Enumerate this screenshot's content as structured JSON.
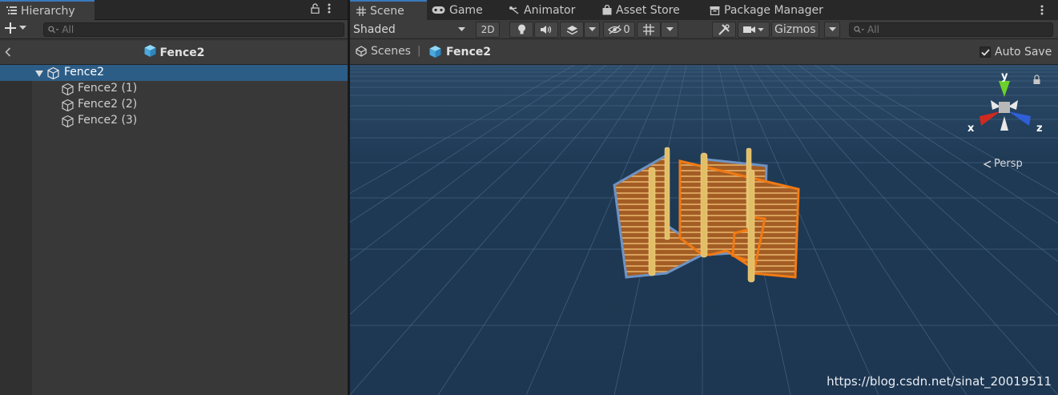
{
  "hierarchy": {
    "tab_label": "Hierarchy",
    "search_placeholder": "All",
    "context_title": "Fence2",
    "items": [
      {
        "label": "Fence2",
        "depth": 0,
        "expanded": true,
        "selected": true
      },
      {
        "label": "Fence2 (1)",
        "depth": 1,
        "expanded": false,
        "selected": false
      },
      {
        "label": "Fence2 (2)",
        "depth": 1,
        "expanded": false,
        "selected": false
      },
      {
        "label": "Fence2 (3)",
        "depth": 1,
        "expanded": false,
        "selected": false
      }
    ]
  },
  "scene_panel": {
    "tabs": [
      {
        "label": "Scene",
        "icon": "grid-icon",
        "active": true
      },
      {
        "label": "Game",
        "icon": "gamepad-icon",
        "active": false
      },
      {
        "label": "Animator",
        "icon": "animator-icon",
        "active": false
      },
      {
        "label": "Asset Store",
        "icon": "store-bag-icon",
        "active": false
      },
      {
        "label": "Package Manager",
        "icon": "package-icon",
        "active": false
      }
    ],
    "toolbar": {
      "draw_mode": "Shaded",
      "mode_2d": "2D",
      "hidden_count": "0",
      "gizmos_label": "Gizmos",
      "search_placeholder": "All"
    },
    "breadcrumb": {
      "scenes_label": "Scenes",
      "separator": "|",
      "prefab_label": "Fence2"
    },
    "auto_save_label": "Auto Save",
    "auto_save_checked": true,
    "gizmo": {
      "x_label": "x",
      "y_label": "y",
      "z_label": "z",
      "projection_label": "Persp"
    },
    "watermark": "https://blog.csdn.net/sinat_20019511"
  },
  "colors": {
    "selection": "#2c5d87",
    "viewport_bg": "#1f3a55",
    "selection_outline": "#f57c14",
    "prefab_blue": "#5cc1f0",
    "axis_x": "#d02a1f",
    "axis_y": "#6dd02a",
    "axis_z": "#2f5fd8"
  }
}
